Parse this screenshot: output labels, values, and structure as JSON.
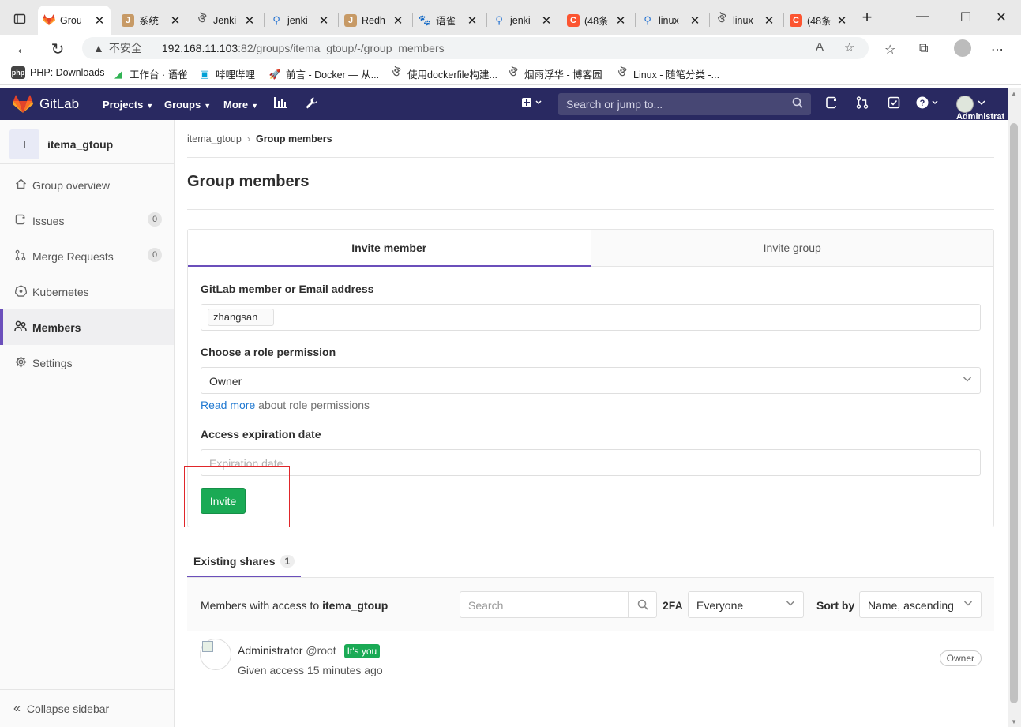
{
  "browser": {
    "tabs": [
      {
        "title": "Grou",
        "favicon": "gitlab-icon",
        "active": true
      },
      {
        "title": "系统",
        "favicon": "jenkins-icon"
      },
      {
        "title": "Jenki",
        "favicon": "cnblogs-icon"
      },
      {
        "title": "jenki",
        "favicon": "search-icon"
      },
      {
        "title": "Redh",
        "favicon": "jenkins-icon"
      },
      {
        "title": "语雀",
        "favicon": "baidu-icon"
      },
      {
        "title": "jenki",
        "favicon": "search-icon"
      },
      {
        "title": "(48条",
        "favicon": "csdn-icon"
      },
      {
        "title": "linux",
        "favicon": "search-icon"
      },
      {
        "title": "linux",
        "favicon": "cnblogs-icon"
      },
      {
        "title": "(48条",
        "favicon": "csdn-icon"
      }
    ],
    "address": {
      "security": "不安全",
      "host": "192.168.11.103",
      "path": ":82/groups/itema_gtoup/-/group_members"
    },
    "bookmarks": [
      {
        "label": "PHP: Downloads",
        "icon_text": "php"
      },
      {
        "label": "工作台 · 语雀"
      },
      {
        "label": "哔哩哔哩"
      },
      {
        "label": "前言 - Docker — 从..."
      },
      {
        "label": "使用dockerfile构建..."
      },
      {
        "label": "烟雨浮华 - 博客园"
      },
      {
        "label": "Linux - 随笔分类 -..."
      }
    ]
  },
  "gitlab": {
    "brand": "GitLab",
    "nav": {
      "projects": "Projects",
      "groups": "Groups",
      "more": "More"
    },
    "search_placeholder": "Search or jump to...",
    "username": "Administrat"
  },
  "sidebar": {
    "group_initial": "I",
    "group_name": "itema_gtoup",
    "items": [
      {
        "label": "Group overview",
        "icon": "home-icon"
      },
      {
        "label": "Issues",
        "icon": "issues-icon",
        "count": "0"
      },
      {
        "label": "Merge Requests",
        "icon": "merge-request-icon",
        "count": "0"
      },
      {
        "label": "Kubernetes",
        "icon": "kubernetes-icon"
      },
      {
        "label": "Members",
        "icon": "users-icon",
        "active": true
      },
      {
        "label": "Settings",
        "icon": "settings-icon"
      }
    ],
    "collapse_label": "Collapse sidebar"
  },
  "main": {
    "breadcrumb": {
      "group": "itema_gtoup",
      "current": "Group members"
    },
    "title": "Group members",
    "invite": {
      "tab_member": "Invite member",
      "tab_group": "Invite group",
      "member_label": "GitLab member or Email address",
      "member_token": "zhangsan",
      "role_label": "Choose a role permission",
      "role_value": "Owner",
      "help_link": "Read more",
      "help_text": " about role permissions",
      "expiry_label": "Access expiration date",
      "expiry_placeholder": "Expiration date",
      "invite_button": "Invite"
    },
    "shares": {
      "tab_label": "Existing shares",
      "count": "1"
    },
    "members": {
      "prefix": "Members with access to ",
      "group": "itema_gtoup",
      "search_placeholder": "Search",
      "twofa_label": "2FA",
      "twofa_value": "Everyone",
      "sort_label": "Sort by",
      "sort_value": "Name, ascending",
      "rows": [
        {
          "name": "Administrator",
          "username": "@root",
          "badge": "It's you",
          "meta": "Given access 15 minutes ago",
          "role": "Owner"
        }
      ]
    }
  },
  "colors": {
    "gitlab_header": "#292961",
    "accent": "#6b4fbb",
    "success": "#1aaa55",
    "link": "#1f78d1",
    "highlight_box": "#e0262a"
  }
}
